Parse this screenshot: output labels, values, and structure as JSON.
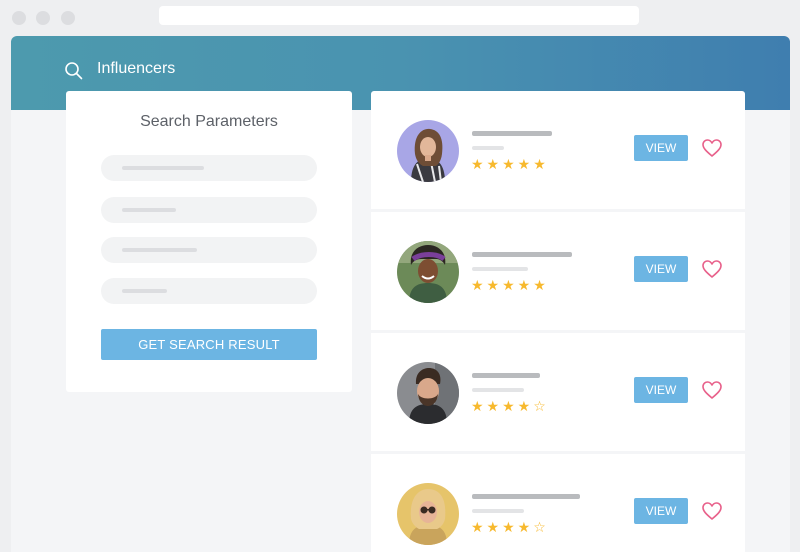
{
  "header": {
    "title": "Influencers",
    "search_icon": "search-icon"
  },
  "search_panel": {
    "title": "Search Parameters",
    "button_label": "GET SEARCH RESULT"
  },
  "results": [
    {
      "rating": "★★★★★",
      "view_label": "VIEW",
      "avatar": "avatar-photo"
    },
    {
      "rating": "★★★★★",
      "view_label": "VIEW",
      "avatar": "avatar-photo"
    },
    {
      "rating": "★★★★☆",
      "view_label": "VIEW",
      "avatar": "avatar-photo"
    },
    {
      "rating": "★★★★☆",
      "view_label": "VIEW",
      "avatar": "avatar-photo"
    }
  ],
  "colors": {
    "header_gradient": [
      "#4d9aae",
      "#3f7eaf"
    ],
    "accent_button": "#6cb5e3",
    "star": "#f7b92e",
    "heart": "#e8608a"
  }
}
